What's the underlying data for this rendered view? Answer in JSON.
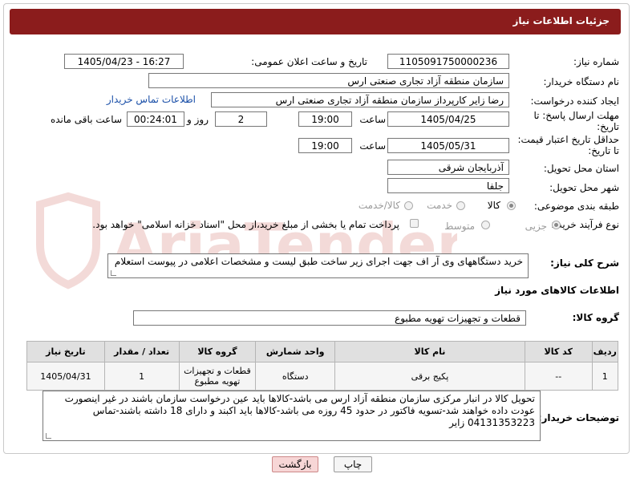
{
  "header": {
    "title": "جزئیات اطلاعات نیاز"
  },
  "form": {
    "need_number_label": "شماره نیاز:",
    "need_number": "1105091750000236",
    "announce_label": "تاریخ و ساعت اعلان عمومی:",
    "announce_value": "1405/04/23 - 16:27",
    "buyer_org_label": "نام دستگاه خریدار:",
    "buyer_org": "سازمان منطقه آزاد تجاری صنعتی ارس",
    "requester_label": "ایجاد کننده درخواست:",
    "requester": "رضا زایر کارپرداز سازمان منطقه آزاد تجاری صنعتی ارس",
    "contact_link": "اطلاعات تماس خریدار",
    "deadline_label_1": "مهلت ارسال پاسخ: تا",
    "deadline_label_2": "تاریخ:",
    "deadline_date": "1405/04/25",
    "time_label": "ساعت",
    "deadline_time": "19:00",
    "days_value": "2",
    "days_label": "روز و",
    "remaining_time": "00:24:01",
    "remaining_label": "ساعت باقی مانده",
    "validity_label_1": "حداقل تاریخ اعتبار قیمت:",
    "validity_label_2": "تا تاریخ:",
    "validity_date": "1405/05/31",
    "validity_time": "19:00",
    "province_label": "استان محل تحویل:",
    "province": "آذربایجان شرقی",
    "city_label": "شهر محل تحویل:",
    "city": "جلفا",
    "category_label": "طبقه بندی موضوعی:",
    "category_options": [
      "کالا",
      "خدمت",
      "کالا/خدمت"
    ],
    "process_label": "نوع فرآیند خرید :",
    "process_options": [
      "جزیی",
      "متوسط"
    ],
    "payment_note": "پرداخت تمام یا بخشی از مبلغ خرید،از محل \"اسناد خزانه اسلامی\" خواهد بود."
  },
  "description": {
    "label": "شرح کلی نیاز:",
    "text": "خرید دستگاههای وی آر اف جهت اجرای زیر ساخت طبق لیست و مشخصات اعلامی در پیوست استعلام"
  },
  "goods": {
    "section_title": "اطلاعات کالاهای مورد نیاز",
    "group_label": "گروه کالا:",
    "group_value": "قطعات و تجهیزات تهویه مطبوع",
    "columns": [
      "ردیف",
      "کد کالا",
      "نام کالا",
      "واحد شمارش",
      "گروه کالا",
      "تعداد / مقدار",
      "تاریخ نیاز"
    ],
    "rows": [
      [
        "1",
        "--",
        "پکیج برقی",
        "دستگاه",
        "قطعات و تجهیزات تهویه مطبوع",
        "1",
        "1405/04/31"
      ]
    ]
  },
  "buyer_notes": {
    "label": "توضیحات خریدار:",
    "text": "تحویل کالا در انبار مرکزی سازمان منطقه آزاد ارس می باشد-کالاها باید عین درخواست سازمان باشند در غیر اینصورت عودت داده خواهند شد-تسویه فاکتور در حدود 45 روزه می باشد-کالاها باید اکبند و دارای 18 داشته باشند-تماس 04131353223 زایر"
  },
  "buttons": {
    "print": "چاپ",
    "back": "بازگشت"
  },
  "watermark": "AriaTender.net",
  "colors": {
    "header": "#8b1c1c",
    "link": "#1a4fa8",
    "back_button": "#f7d6d6"
  }
}
